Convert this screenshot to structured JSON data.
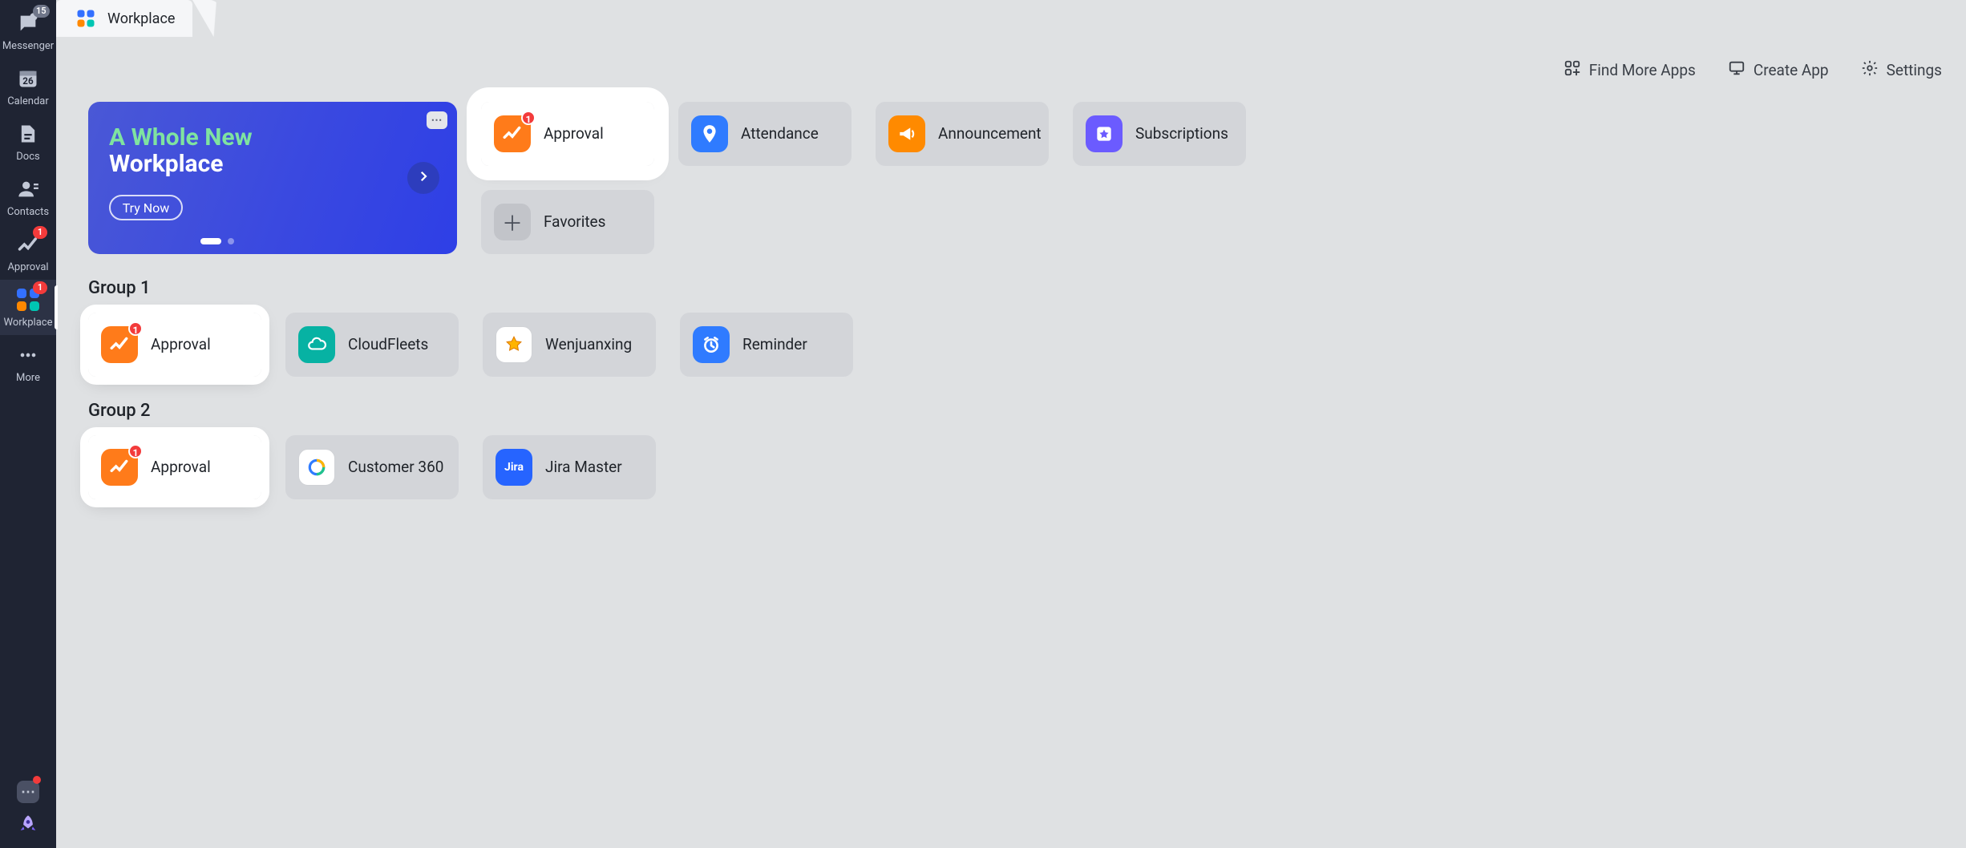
{
  "sidebar": {
    "items": [
      {
        "label": "Messenger",
        "badge": "15"
      },
      {
        "label": "Calendar",
        "day": "26"
      },
      {
        "label": "Docs"
      },
      {
        "label": "Contacts"
      },
      {
        "label": "Approval",
        "badge": "1"
      },
      {
        "label": "Workplace",
        "badge": "1",
        "active": true
      },
      {
        "label": "More"
      }
    ]
  },
  "tab": {
    "title": "Workplace"
  },
  "actions": {
    "find": "Find More Apps",
    "create": "Create App",
    "settings": "Settings"
  },
  "promo": {
    "line1": "A Whole New",
    "line2": "Workplace",
    "cta": "Try Now"
  },
  "top_apps": [
    {
      "key": "approval",
      "label": "Approval",
      "badge": "1",
      "highlight": true
    },
    {
      "key": "attendance",
      "label": "Attendance"
    },
    {
      "key": "announce",
      "label": "Announcement"
    },
    {
      "key": "subs",
      "label": "Subscriptions"
    }
  ],
  "favorites_label": "Favorites",
  "groups": [
    {
      "title": "Group 1",
      "apps": [
        {
          "key": "approval",
          "label": "Approval",
          "badge": "1",
          "highlight": true
        },
        {
          "key": "cloud",
          "label": "CloudFleets"
        },
        {
          "key": "star",
          "label": "Wenjuanxing"
        },
        {
          "key": "clock",
          "label": "Reminder"
        }
      ]
    },
    {
      "title": "Group 2",
      "apps": [
        {
          "key": "approval",
          "label": "Approval",
          "badge": "1",
          "highlight": true
        },
        {
          "key": "c360",
          "label": "Customer 360"
        },
        {
          "key": "jira",
          "label": "Jira Master"
        }
      ]
    }
  ]
}
